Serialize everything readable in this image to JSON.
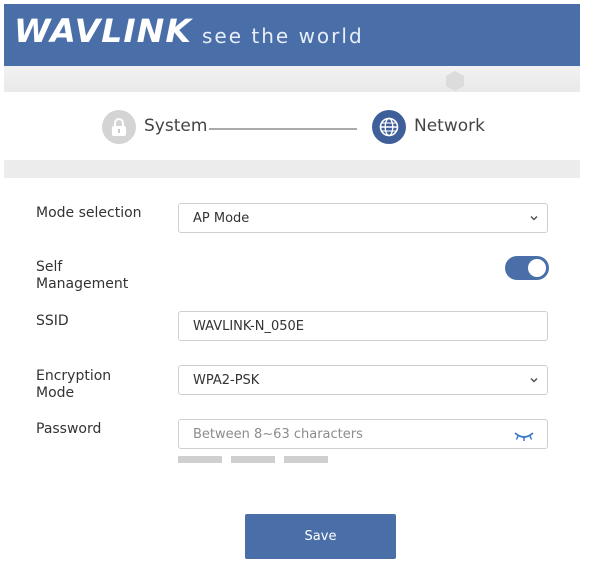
{
  "header": {
    "logo": "WAVLINK",
    "tagline": "see the world",
    "background_color": "#4a6fa8"
  },
  "stepper": {
    "steps": [
      {
        "label": "System",
        "icon": "lock-icon",
        "active": false
      },
      {
        "label": "Network",
        "icon": "globe-icon",
        "active": true
      }
    ]
  },
  "form": {
    "mode_selection": {
      "label": "Mode selection",
      "value": "AP Mode"
    },
    "self_management": {
      "label_line1": "Self",
      "label_line2": "Management",
      "enabled": true
    },
    "ssid": {
      "label": "SSID",
      "value": "WAVLINK-N_050E"
    },
    "encryption_mode": {
      "label_line1": "Encryption",
      "label_line2": "Mode",
      "value": "WPA2-PSK"
    },
    "password": {
      "label": "Password",
      "placeholder": "Between 8~63 characters",
      "value": ""
    }
  },
  "actions": {
    "save_label": "Save"
  },
  "colors": {
    "accent": "#4a6fa8",
    "step_inactive": "#d4d4d4",
    "strength_bar": "#cfcfcf"
  }
}
